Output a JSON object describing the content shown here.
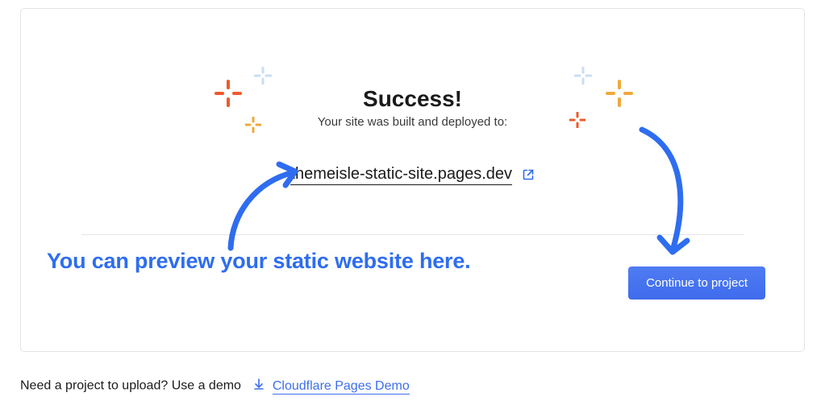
{
  "card": {
    "title": "Success!",
    "subtitle": "Your site was built and deployed to:",
    "site_url": "themeisle-static-site.pages.dev",
    "continue_label": "Continue to project"
  },
  "annotation": {
    "preview_hint": "You can preview your static website here."
  },
  "footer": {
    "prompt": "Need a project to upload? Use a demo",
    "demo_link_label": "Cloudflare Pages Demo"
  }
}
